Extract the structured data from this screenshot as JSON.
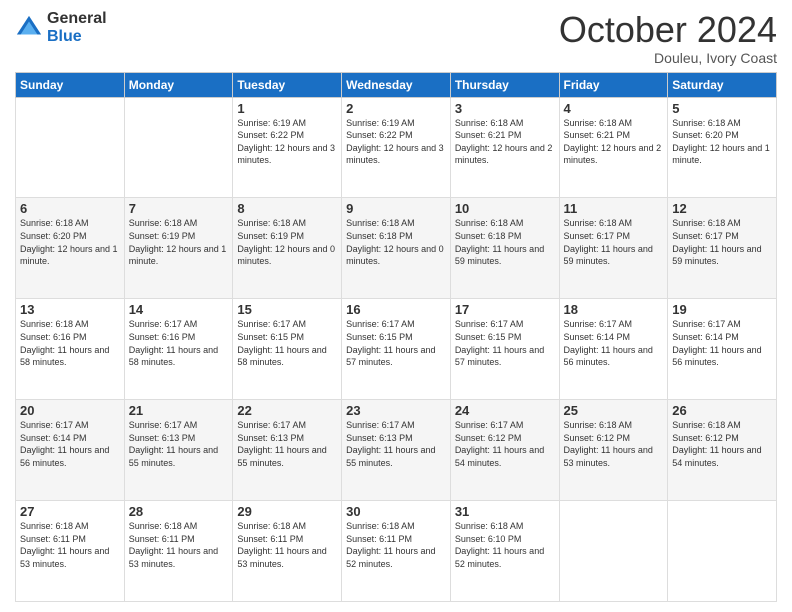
{
  "logo": {
    "general": "General",
    "blue": "Blue"
  },
  "header": {
    "month": "October 2024",
    "location": "Douleu, Ivory Coast"
  },
  "days_of_week": [
    "Sunday",
    "Monday",
    "Tuesday",
    "Wednesday",
    "Thursday",
    "Friday",
    "Saturday"
  ],
  "weeks": [
    [
      {
        "day": "",
        "info": ""
      },
      {
        "day": "",
        "info": ""
      },
      {
        "day": "1",
        "info": "Sunrise: 6:19 AM\nSunset: 6:22 PM\nDaylight: 12 hours and 3 minutes."
      },
      {
        "day": "2",
        "info": "Sunrise: 6:19 AM\nSunset: 6:22 PM\nDaylight: 12 hours and 3 minutes."
      },
      {
        "day": "3",
        "info": "Sunrise: 6:18 AM\nSunset: 6:21 PM\nDaylight: 12 hours and 2 minutes."
      },
      {
        "day": "4",
        "info": "Sunrise: 6:18 AM\nSunset: 6:21 PM\nDaylight: 12 hours and 2 minutes."
      },
      {
        "day": "5",
        "info": "Sunrise: 6:18 AM\nSunset: 6:20 PM\nDaylight: 12 hours and 1 minute."
      }
    ],
    [
      {
        "day": "6",
        "info": "Sunrise: 6:18 AM\nSunset: 6:20 PM\nDaylight: 12 hours and 1 minute."
      },
      {
        "day": "7",
        "info": "Sunrise: 6:18 AM\nSunset: 6:19 PM\nDaylight: 12 hours and 1 minute."
      },
      {
        "day": "8",
        "info": "Sunrise: 6:18 AM\nSunset: 6:19 PM\nDaylight: 12 hours and 0 minutes."
      },
      {
        "day": "9",
        "info": "Sunrise: 6:18 AM\nSunset: 6:18 PM\nDaylight: 12 hours and 0 minutes."
      },
      {
        "day": "10",
        "info": "Sunrise: 6:18 AM\nSunset: 6:18 PM\nDaylight: 11 hours and 59 minutes."
      },
      {
        "day": "11",
        "info": "Sunrise: 6:18 AM\nSunset: 6:17 PM\nDaylight: 11 hours and 59 minutes."
      },
      {
        "day": "12",
        "info": "Sunrise: 6:18 AM\nSunset: 6:17 PM\nDaylight: 11 hours and 59 minutes."
      }
    ],
    [
      {
        "day": "13",
        "info": "Sunrise: 6:18 AM\nSunset: 6:16 PM\nDaylight: 11 hours and 58 minutes."
      },
      {
        "day": "14",
        "info": "Sunrise: 6:17 AM\nSunset: 6:16 PM\nDaylight: 11 hours and 58 minutes."
      },
      {
        "day": "15",
        "info": "Sunrise: 6:17 AM\nSunset: 6:15 PM\nDaylight: 11 hours and 58 minutes."
      },
      {
        "day": "16",
        "info": "Sunrise: 6:17 AM\nSunset: 6:15 PM\nDaylight: 11 hours and 57 minutes."
      },
      {
        "day": "17",
        "info": "Sunrise: 6:17 AM\nSunset: 6:15 PM\nDaylight: 11 hours and 57 minutes."
      },
      {
        "day": "18",
        "info": "Sunrise: 6:17 AM\nSunset: 6:14 PM\nDaylight: 11 hours and 56 minutes."
      },
      {
        "day": "19",
        "info": "Sunrise: 6:17 AM\nSunset: 6:14 PM\nDaylight: 11 hours and 56 minutes."
      }
    ],
    [
      {
        "day": "20",
        "info": "Sunrise: 6:17 AM\nSunset: 6:14 PM\nDaylight: 11 hours and 56 minutes."
      },
      {
        "day": "21",
        "info": "Sunrise: 6:17 AM\nSunset: 6:13 PM\nDaylight: 11 hours and 55 minutes."
      },
      {
        "day": "22",
        "info": "Sunrise: 6:17 AM\nSunset: 6:13 PM\nDaylight: 11 hours and 55 minutes."
      },
      {
        "day": "23",
        "info": "Sunrise: 6:17 AM\nSunset: 6:13 PM\nDaylight: 11 hours and 55 minutes."
      },
      {
        "day": "24",
        "info": "Sunrise: 6:17 AM\nSunset: 6:12 PM\nDaylight: 11 hours and 54 minutes."
      },
      {
        "day": "25",
        "info": "Sunrise: 6:18 AM\nSunset: 6:12 PM\nDaylight: 11 hours and 53 minutes."
      },
      {
        "day": "26",
        "info": "Sunrise: 6:18 AM\nSunset: 6:12 PM\nDaylight: 11 hours and 54 minutes."
      }
    ],
    [
      {
        "day": "27",
        "info": "Sunrise: 6:18 AM\nSunset: 6:11 PM\nDaylight: 11 hours and 53 minutes."
      },
      {
        "day": "28",
        "info": "Sunrise: 6:18 AM\nSunset: 6:11 PM\nDaylight: 11 hours and 53 minutes."
      },
      {
        "day": "29",
        "info": "Sunrise: 6:18 AM\nSunset: 6:11 PM\nDaylight: 11 hours and 53 minutes."
      },
      {
        "day": "30",
        "info": "Sunrise: 6:18 AM\nSunset: 6:11 PM\nDaylight: 11 hours and 52 minutes."
      },
      {
        "day": "31",
        "info": "Sunrise: 6:18 AM\nSunset: 6:10 PM\nDaylight: 11 hours and 52 minutes."
      },
      {
        "day": "",
        "info": ""
      },
      {
        "day": "",
        "info": ""
      }
    ]
  ]
}
